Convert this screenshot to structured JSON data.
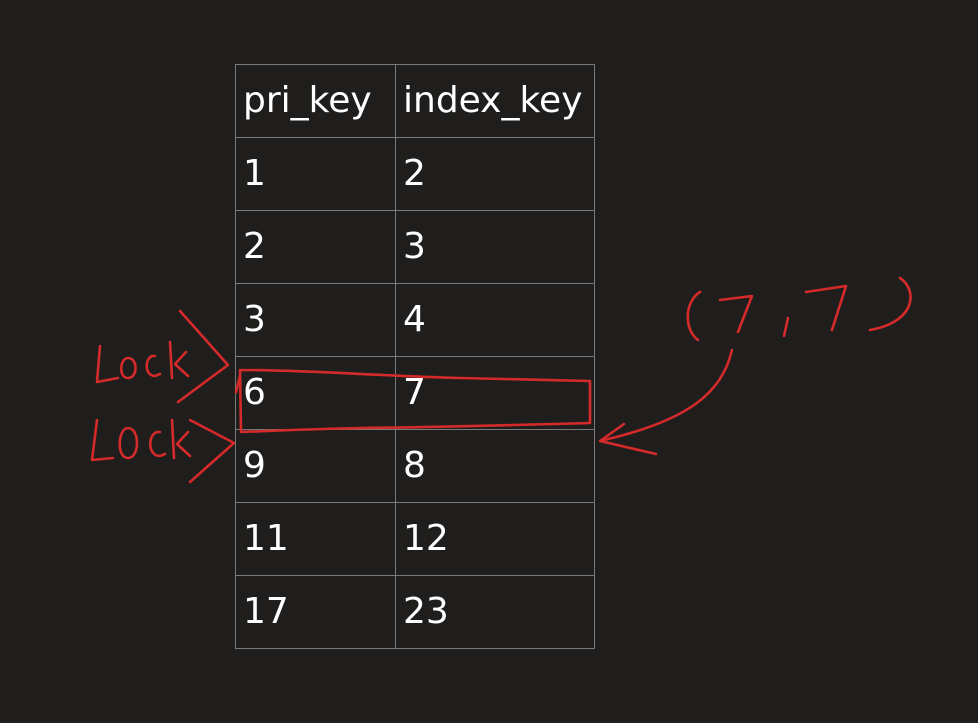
{
  "table": {
    "headers": [
      "pri_key",
      "index_key"
    ],
    "rows": [
      [
        "1",
        "2"
      ],
      [
        "2",
        "3"
      ],
      [
        "3",
        "4"
      ],
      [
        "6",
        "7"
      ],
      [
        "9",
        "8"
      ],
      [
        "11",
        "12"
      ],
      [
        "17",
        "23"
      ]
    ]
  },
  "annotations": {
    "lock_label_1": "Lock",
    "lock_label_2": "LOCK",
    "insert_label": "(7,7)",
    "ink_color": "#d42a2a",
    "highlighted_row": "6 / 7"
  }
}
